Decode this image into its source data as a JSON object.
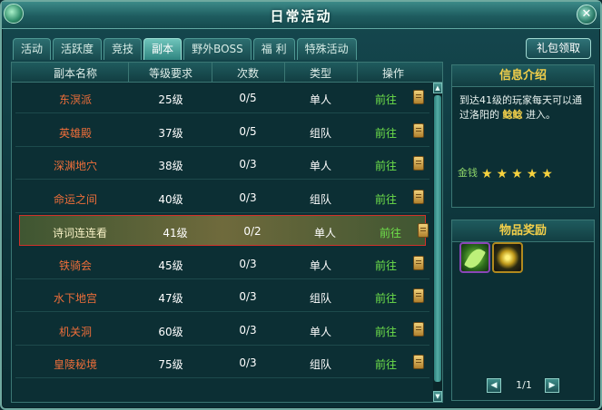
{
  "window": {
    "title": "日常活动",
    "close_label": "✕"
  },
  "tabs": [
    {
      "label": "活动",
      "active": false
    },
    {
      "label": "活跃度",
      "active": false
    },
    {
      "label": "竞技",
      "active": false
    },
    {
      "label": "副本",
      "active": true
    },
    {
      "label": "野外BOSS",
      "active": false
    },
    {
      "label": "福 利",
      "active": false
    },
    {
      "label": "特殊活动",
      "active": false
    }
  ],
  "gift_button": "礼包领取",
  "table": {
    "headers": {
      "name": "副本名称",
      "level": "等级要求",
      "count": "次数",
      "type": "类型",
      "action": "操作"
    },
    "rows": [
      {
        "name": "东溟派",
        "level": "25级",
        "count": "0/5",
        "type": "单人",
        "action": "前往"
      },
      {
        "name": "英雄殿",
        "level": "37级",
        "count": "0/5",
        "type": "组队",
        "action": "前往"
      },
      {
        "name": "深渊地穴",
        "level": "38级",
        "count": "0/3",
        "type": "单人",
        "action": "前往"
      },
      {
        "name": "命运之间",
        "level": "40级",
        "count": "0/3",
        "type": "组队",
        "action": "前往"
      },
      {
        "name": "诗词连连看",
        "level": "41级",
        "count": "0/2",
        "type": "单人",
        "action": "前往",
        "selected": true
      },
      {
        "name": "铁骑会",
        "level": "45级",
        "count": "0/3",
        "type": "单人",
        "action": "前往"
      },
      {
        "name": "水下地宫",
        "level": "47级",
        "count": "0/3",
        "type": "组队",
        "action": "前往"
      },
      {
        "name": "机关洞",
        "level": "60级",
        "count": "0/3",
        "type": "单人",
        "action": "前往"
      },
      {
        "name": "皇陵秘境",
        "level": "75级",
        "count": "0/3",
        "type": "组队",
        "action": "前往"
      }
    ]
  },
  "info": {
    "title": "信息介绍",
    "text_before": "到达41级的玩家每天可以通过洛阳的",
    "npc": "鲶鲶",
    "text_after": "进入。",
    "money_label": "金钱",
    "money_stars": 5
  },
  "reward": {
    "title": "物品奖励",
    "page": "1/1"
  },
  "colors": {
    "accent_gold": "#f2cf4a",
    "instance_name": "#ee6e3a",
    "go_link": "#6ee04a",
    "selected_border": "#d0312a"
  }
}
